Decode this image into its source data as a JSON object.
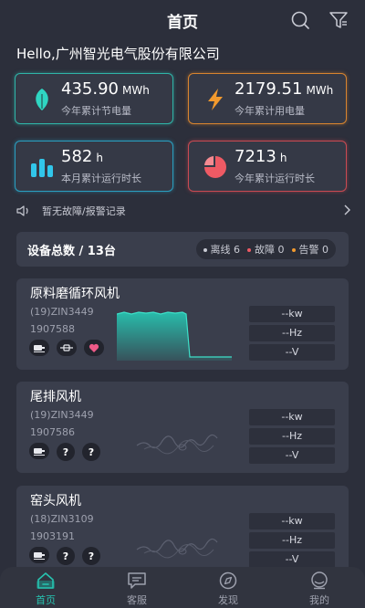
{
  "header": {
    "title": "首页",
    "search_icon": "search-icon",
    "filter_icon": "filter-icon"
  },
  "greeting": "Hello,广州智光电气股份有限公司",
  "stats": [
    {
      "value": "435.90",
      "unit": "MWh",
      "label": "今年累计节电量",
      "icon": "leaf-icon",
      "color": "#2fd6c2"
    },
    {
      "value": "2179.51",
      "unit": "MWh",
      "label": "今年累计用电量",
      "icon": "lightning-icon",
      "color": "#f29a2e"
    },
    {
      "value": "582",
      "unit": "h",
      "label": "本月累计运行时长",
      "icon": "bar-chart-icon",
      "color": "#31c6ea"
    },
    {
      "value": "7213",
      "unit": "h",
      "label": "今年累计运行时长",
      "icon": "pie-chart-icon",
      "color": "#ee5a64"
    }
  ],
  "notice": {
    "text": "暂无故障/报警记录",
    "icon": "speaker-icon"
  },
  "summary": {
    "total": "设备总数 / 13台",
    "offline": "离线 6",
    "fault": "故障 0",
    "alarm": "告警 0",
    "offline_color": "#c9cbd4",
    "fault_color": "#ee5a64",
    "alarm_color": "#f29a2e"
  },
  "devices": [
    {
      "name": "原料磨循环风机",
      "code": "(19)ZIN3449",
      "number": "1907588",
      "readings": [
        "--kw",
        "--Hz",
        "--V"
      ],
      "icons": [
        "motor-icon",
        "coupling-icon",
        "heart-icon"
      ]
    },
    {
      "name": "尾排风机",
      "code": "(19)ZIN3449",
      "number": "1907586",
      "readings": [
        "--kw",
        "--Hz",
        "--V"
      ],
      "icons": [
        "motor-icon",
        "question-icon",
        "question-icon"
      ]
    },
    {
      "name": "窑头风机",
      "code": "(18)ZIN3109",
      "number": "1903191",
      "readings": [
        "--kw",
        "--Hz",
        "--V"
      ],
      "icons": [
        "motor-icon",
        "question-icon",
        "question-icon"
      ]
    }
  ],
  "tabs": [
    {
      "label": "首页",
      "icon": "home-icon",
      "active": true
    },
    {
      "label": "客服",
      "icon": "message-icon",
      "active": false
    },
    {
      "label": "发现",
      "icon": "compass-icon",
      "active": false
    },
    {
      "label": "我的",
      "icon": "profile-icon",
      "active": false
    }
  ]
}
